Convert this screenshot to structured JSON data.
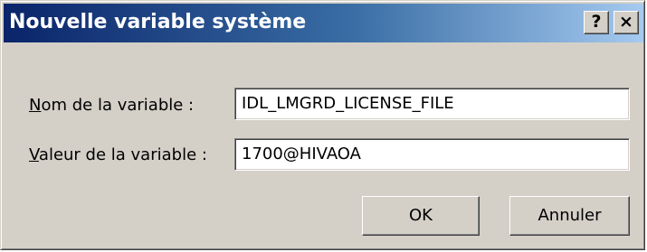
{
  "window": {
    "title": "Nouvelle variable système",
    "help_label": "?",
    "close_label": "×"
  },
  "form": {
    "name_label_accel": "N",
    "name_label_rest": "om de la variable :",
    "name_value": "IDL_LMGRD_LICENSE_FILE",
    "value_label_accel": "V",
    "value_label_rest": "aleur de la variable :",
    "value_value": "1700@HIVAOA"
  },
  "buttons": {
    "ok": "OK",
    "cancel": "Annuler"
  },
  "colors": {
    "titlebar_start": "#0a246a",
    "titlebar_end": "#a6caf0",
    "dialog_face": "#d4d0c8"
  },
  "icons": {
    "help": "help-icon",
    "close": "close-icon"
  }
}
